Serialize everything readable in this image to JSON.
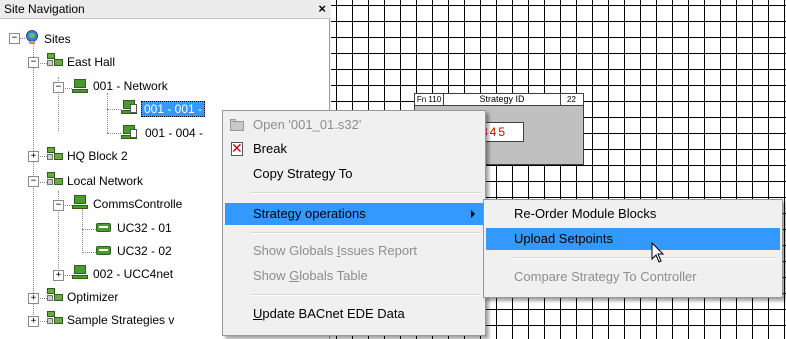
{
  "panel": {
    "title": "Site Navigation",
    "close": "×"
  },
  "tree": {
    "sites": "Sites",
    "east_hall": "East Hall",
    "network_001": "001 - Network",
    "node_001_001": "001 - 001 -",
    "node_001_004": "001 - 004 -",
    "hq_block_2": "HQ Block 2",
    "local_network": "Local Network",
    "comms_controller": "CommsControlle",
    "uc32_01": "UC32 - 01",
    "uc32_02": "UC32 - 02",
    "ucc4net": "002 - UCC4net",
    "optimizer": "Optimizer",
    "sample_strategies": "Sample Strategies v",
    "expander_plus": "+",
    "expander_minus": "−"
  },
  "strategy_block": {
    "fn": "Fn 110",
    "title": "Strategy ID",
    "num": "22",
    "value": "345"
  },
  "context_menu": {
    "open": "Open '001_01.s32'",
    "break": "Break",
    "copy": "Copy Strategy To",
    "strategy_ops": "Strategy operations",
    "show_globals_issues_pre": "Show Globals ",
    "show_globals_issues_u": "I",
    "show_globals_issues_post": "ssues Report",
    "show_globals_table_pre": "Show ",
    "show_globals_table_u": "G",
    "show_globals_table_post": "lobals Table",
    "update_bacnet_u": "U",
    "update_bacnet_post": "pdate BACnet EDE Data"
  },
  "submenu": {
    "reorder": "Re-Order Module Blocks",
    "upload": "Upload Setpoints",
    "compare": "Compare Strategy To Controller"
  },
  "colors": {
    "highlight": "#3399ff",
    "disabled": "#8d8d8d",
    "value_red": "#d00000"
  }
}
